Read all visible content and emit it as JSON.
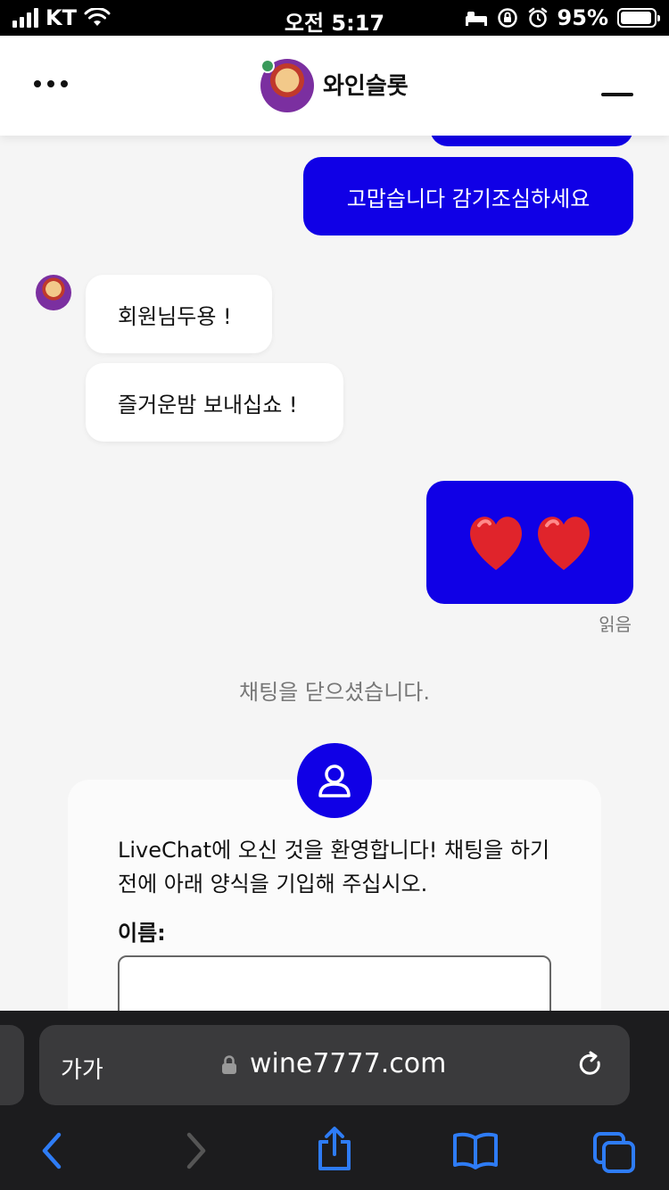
{
  "status_bar": {
    "carrier": "KT",
    "time": "오전 5:17",
    "battery": "95%",
    "battery_level": 0.95
  },
  "header": {
    "title": "와인슬롯",
    "menu_icon": "more-dots-icon",
    "minimize_icon": "minimize-icon"
  },
  "messages": {
    "out1": "고맙습니다 감기조심하세요",
    "in1": "회원님두용 !",
    "in2": "즐거운밤 보내십쇼 !",
    "out2_emoji": "❤️❤️",
    "read_status": "읽음",
    "system": "채팅을 닫으셨습니다."
  },
  "form": {
    "welcome": "LiveChat에 오신 것을 환영합니다! 채팅을 하기 전에 아래 양식을 기입해 주십시오.",
    "name_label": "이름:",
    "name_value": ""
  },
  "browser": {
    "text_size": "가가",
    "url": "wine7777.com"
  },
  "colors": {
    "accent": "#1000e6",
    "online": "#3a9a5b"
  }
}
